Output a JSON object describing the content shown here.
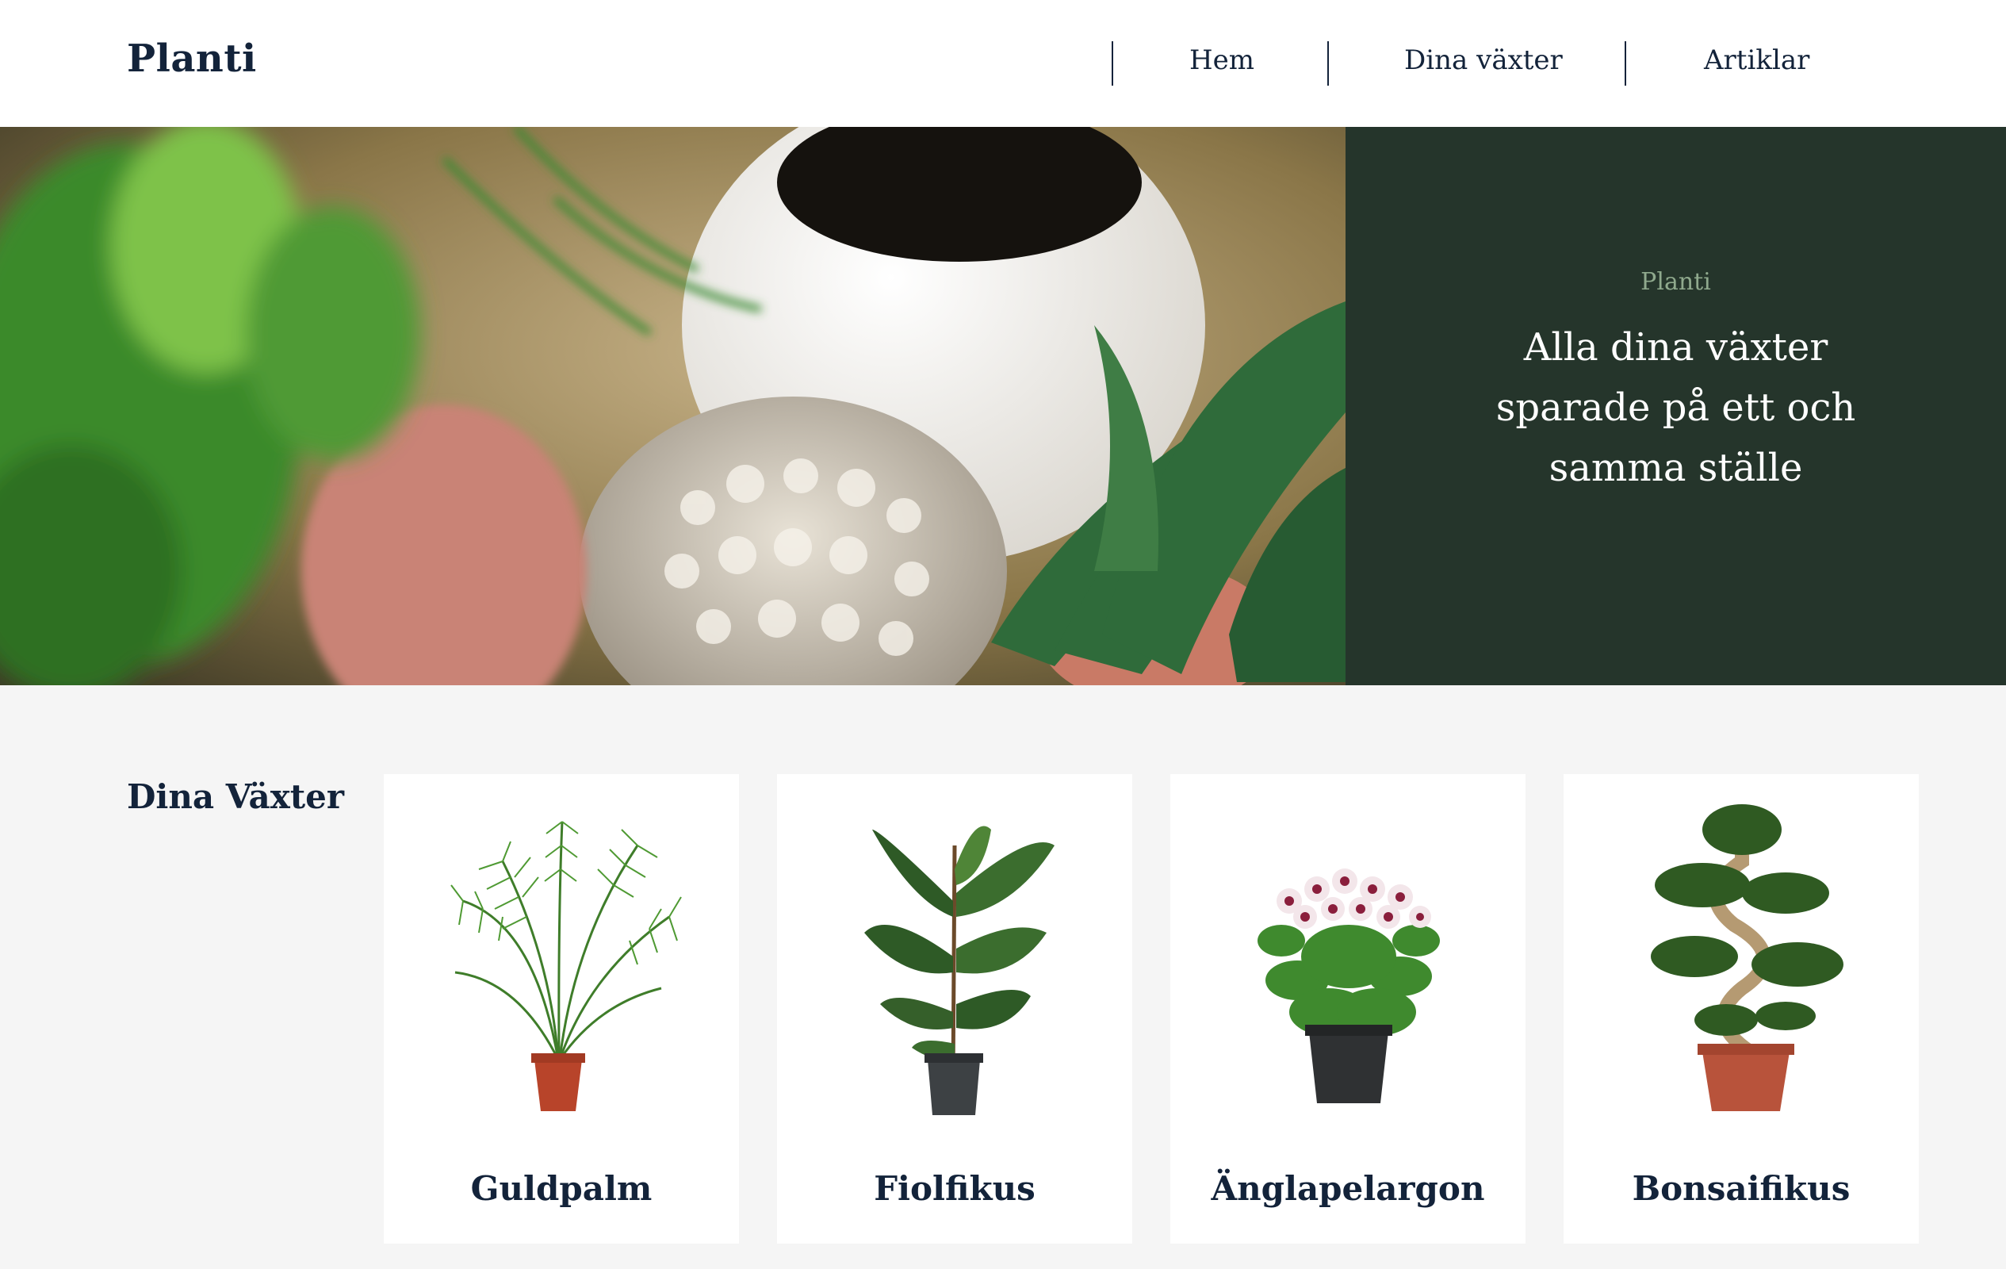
{
  "header": {
    "logo": "Planti",
    "nav": [
      {
        "label": "Hem"
      },
      {
        "label": "Dina växter"
      },
      {
        "label": "Artiklar"
      }
    ]
  },
  "hero": {
    "kicker": "Planti",
    "heading": "Alla dina växter sparade på ett och samma ställe"
  },
  "plants": {
    "section_title": "Dina Växter",
    "items": [
      {
        "name": "Guldpalm",
        "icon": "palm-plant-icon",
        "pot_color": "#b8442a"
      },
      {
        "name": "Fiolfikus",
        "icon": "fig-plant-icon",
        "pot_color": "#3d4144"
      },
      {
        "name": "Änglapelargon",
        "icon": "flower-plant-icon",
        "pot_color": "#2f3133"
      },
      {
        "name": "Bonsaifikus",
        "icon": "bonsai-plant-icon",
        "pot_color": "#b8533b"
      }
    ]
  },
  "colors": {
    "panel": "#25352b",
    "text": "#13233a",
    "kicker": "#8fa98d",
    "background": "#f5f5f5"
  }
}
